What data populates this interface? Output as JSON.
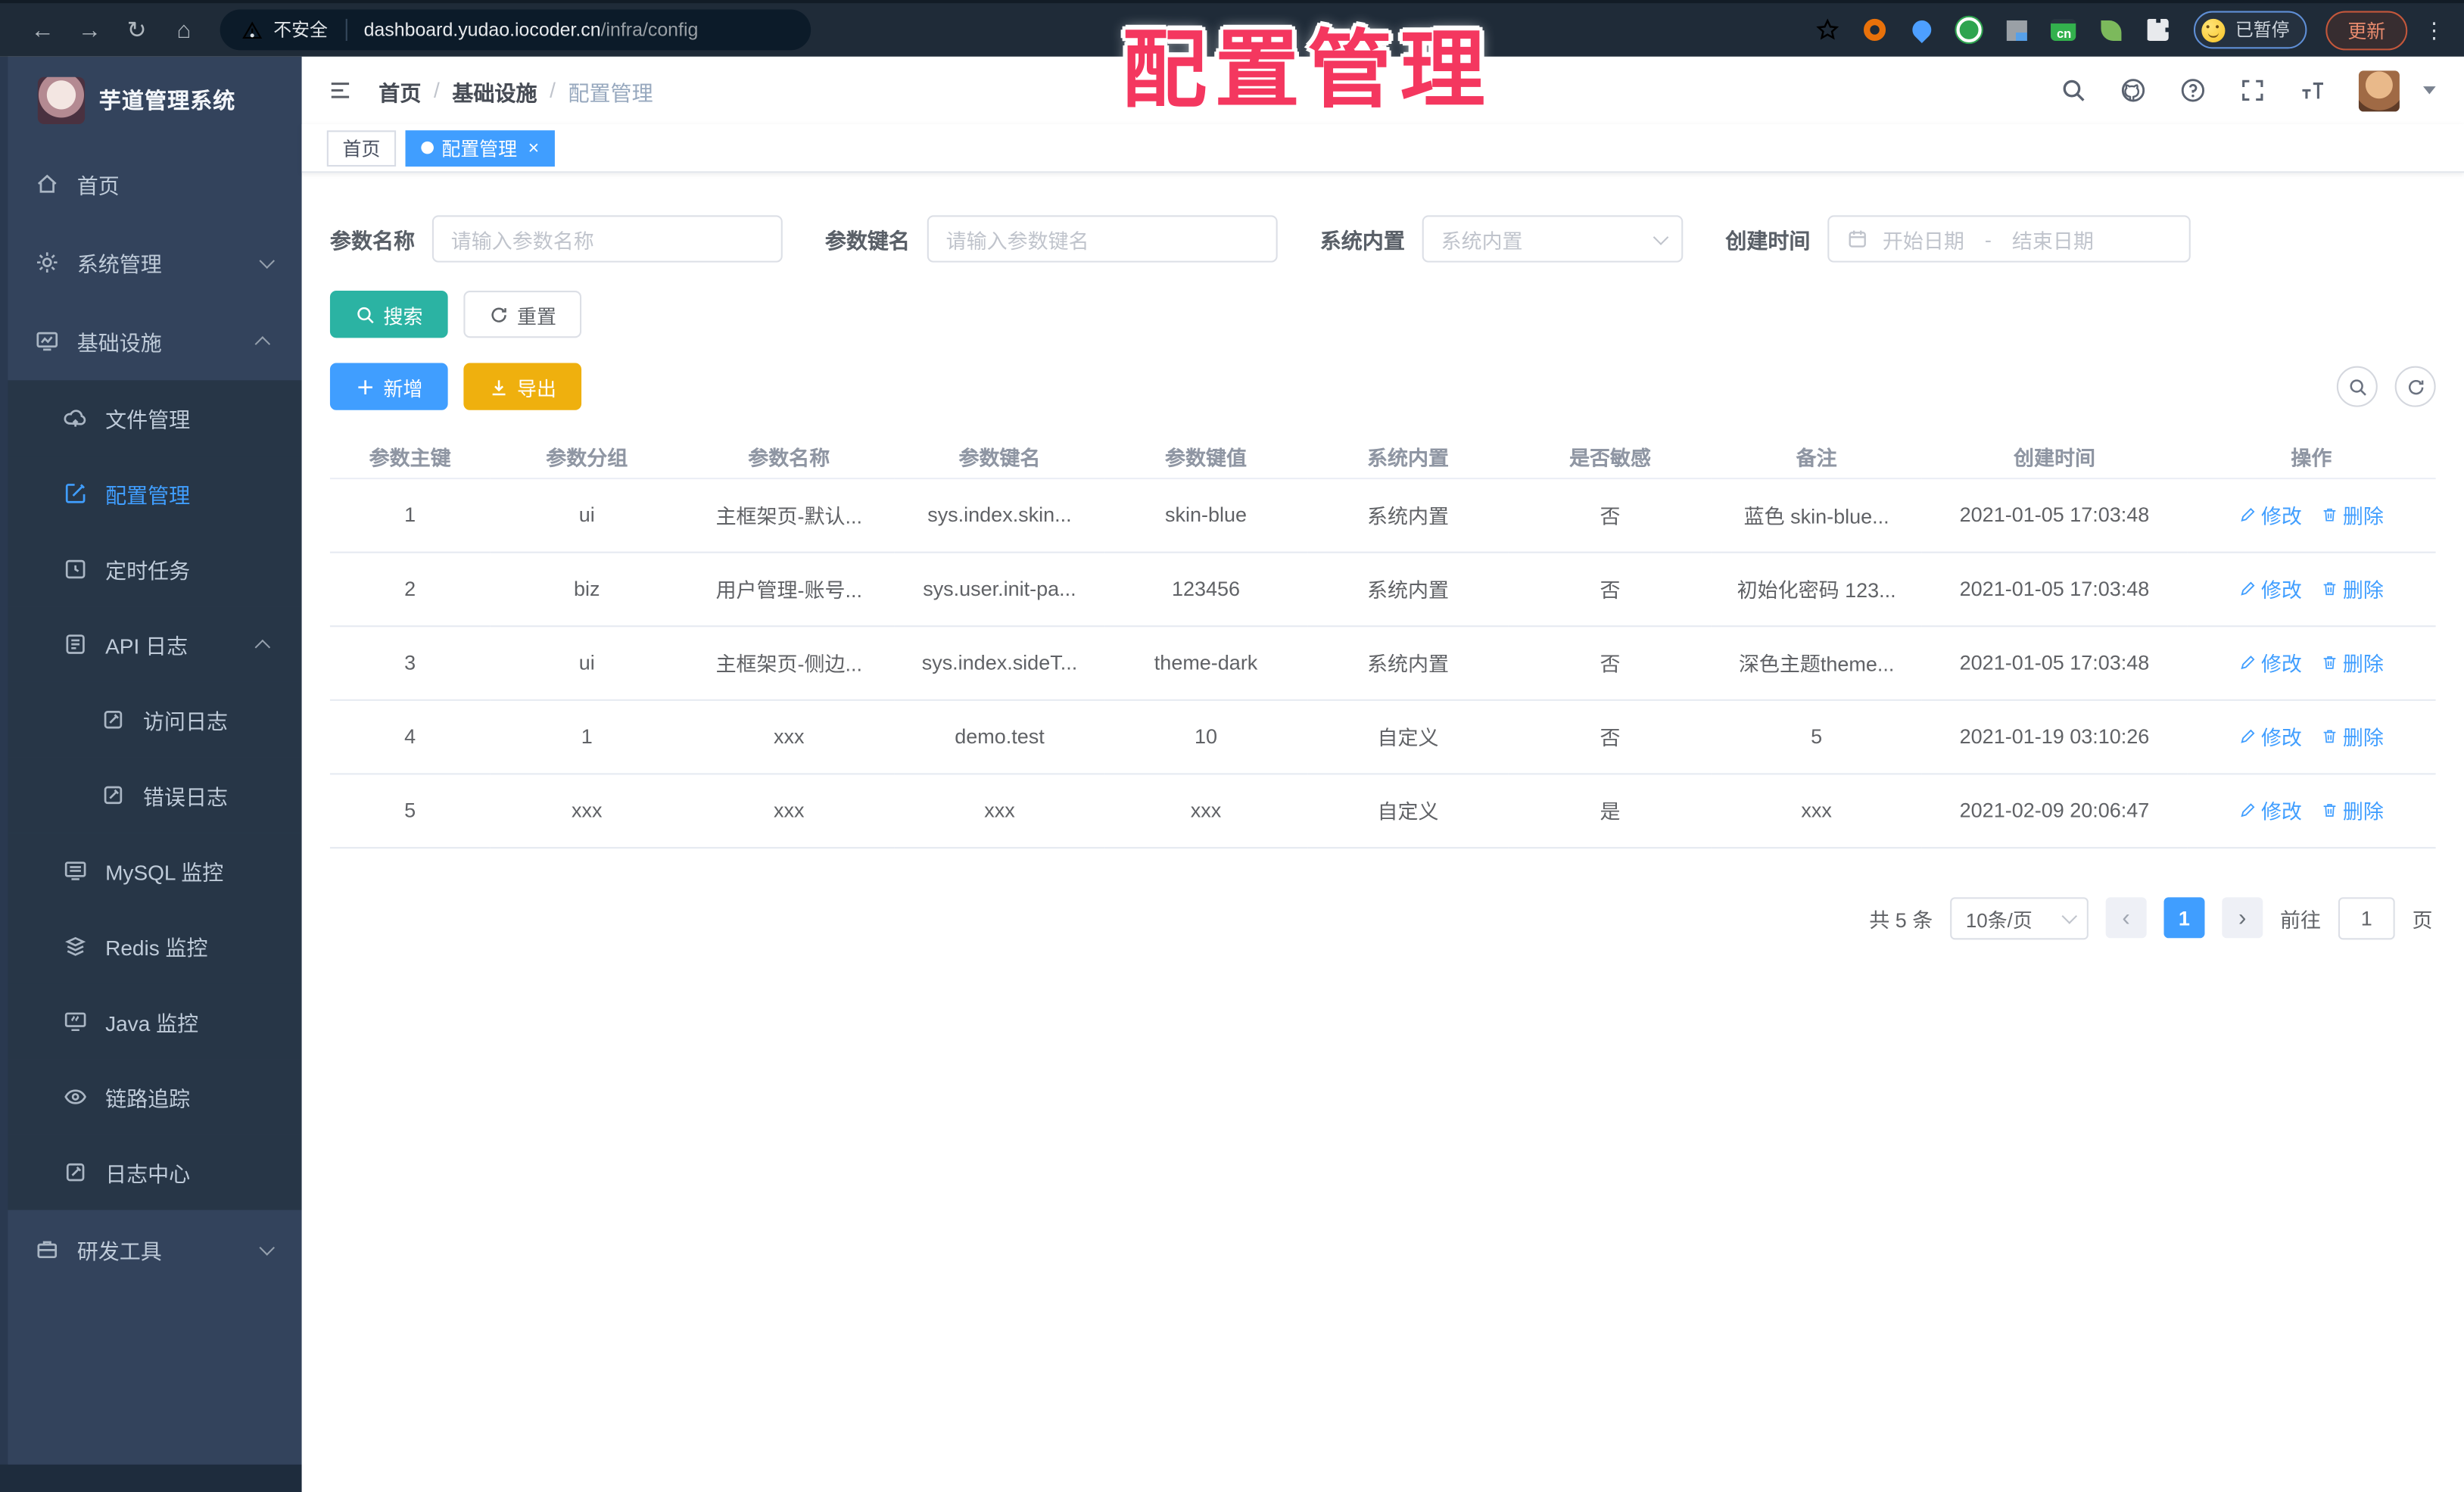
{
  "browser": {
    "security_label": "不安全",
    "url_host": "dashboard.yudao.iocoder.cn",
    "url_path": "/infra/config",
    "paused_badge": "已暂停",
    "update_button": "更新",
    "menu_dots": "⋮",
    "nav": {
      "back": "←",
      "forward": "→",
      "reload": "↻",
      "home": "⌂"
    }
  },
  "overlay_title": "配置管理",
  "sidebar": {
    "logo_title": "芋道管理系统",
    "items": [
      {
        "label": "首页",
        "icon": "home-icon",
        "level": 1
      },
      {
        "label": "系统管理",
        "icon": "gear-icon",
        "level": 1,
        "chevron": "down"
      },
      {
        "label": "基础设施",
        "icon": "infra-icon",
        "level": 1,
        "chevron": "up"
      },
      {
        "label": "文件管理",
        "icon": "file-cloud-icon",
        "level": 2
      },
      {
        "label": "配置管理",
        "icon": "config-edit-icon",
        "level": 2,
        "active": true
      },
      {
        "label": "定时任务",
        "icon": "timer-icon",
        "level": 2
      },
      {
        "label": "API 日志",
        "icon": "api-log-icon",
        "level": 2,
        "chevron": "up"
      },
      {
        "label": "访问日志",
        "icon": "access-log-icon",
        "level": 3
      },
      {
        "label": "错误日志",
        "icon": "error-log-icon",
        "level": 3
      },
      {
        "label": "MySQL 监控",
        "icon": "mysql-icon",
        "level": 2
      },
      {
        "label": "Redis 监控",
        "icon": "redis-icon",
        "level": 2
      },
      {
        "label": "Java 监控",
        "icon": "java-icon",
        "level": 2
      },
      {
        "label": "链路追踪",
        "icon": "trace-eye-icon",
        "level": 2
      },
      {
        "label": "日志中心",
        "icon": "log-center-icon",
        "level": 2
      },
      {
        "label": "研发工具",
        "icon": "devtools-icon",
        "level": 1,
        "chevron": "down"
      }
    ]
  },
  "breadcrumb": {
    "items": [
      "首页",
      "基础设施",
      "配置管理"
    ],
    "separator": "/"
  },
  "tabs": [
    {
      "label": "首页",
      "active": false
    },
    {
      "label": "配置管理",
      "active": true
    }
  ],
  "filters": {
    "name_label": "参数名称",
    "name_placeholder": "请输入参数名称",
    "key_label": "参数键名",
    "key_placeholder": "请输入参数键名",
    "type_label": "系统内置",
    "type_placeholder": "系统内置",
    "date_label": "创建时间",
    "date_start_placeholder": "开始日期",
    "date_range_separator": "-",
    "date_end_placeholder": "结束日期"
  },
  "toolbar": {
    "search": "搜索",
    "reset": "重置",
    "add": "新增",
    "export": "导出"
  },
  "table": {
    "columns": [
      "参数主键",
      "参数分组",
      "参数名称",
      "参数键名",
      "参数键值",
      "系统内置",
      "是否敏感",
      "备注",
      "创建时间",
      "操作"
    ],
    "rows": [
      [
        "1",
        "ui",
        "主框架页-默认...",
        "sys.index.skin...",
        "skin-blue",
        "系统内置",
        "否",
        "蓝色 skin-blue...",
        "2021-01-05 17:03:48"
      ],
      [
        "2",
        "biz",
        "用户管理-账号...",
        "sys.user.init-pa...",
        "123456",
        "系统内置",
        "否",
        "初始化密码 123...",
        "2021-01-05 17:03:48"
      ],
      [
        "3",
        "ui",
        "主框架页-侧边...",
        "sys.index.sideT...",
        "theme-dark",
        "系统内置",
        "否",
        "深色主题theme...",
        "2021-01-05 17:03:48"
      ],
      [
        "4",
        "1",
        "xxx",
        "demo.test",
        "10",
        "自定义",
        "否",
        "5",
        "2021-01-19 03:10:26"
      ],
      [
        "5",
        "xxx",
        "xxx",
        "xxx",
        "xxx",
        "自定义",
        "是",
        "xxx",
        "2021-02-09 20:06:47"
      ]
    ],
    "actions": [
      "修改",
      "删除"
    ]
  },
  "pagination": {
    "total": "共 5 条",
    "page_size": "10条/页",
    "prev": "‹",
    "next": "›",
    "current_page": "1",
    "goto_label": "前往",
    "goto_value": "1",
    "page_unit": "页"
  },
  "colors": {
    "accent": "#409eff",
    "search_teal": "#2bb3a3",
    "export_yellow": "#efb00e",
    "overlay_red": "#f4375f",
    "sidebar_bg": "#33435c",
    "submenu_bg": "#273647"
  }
}
